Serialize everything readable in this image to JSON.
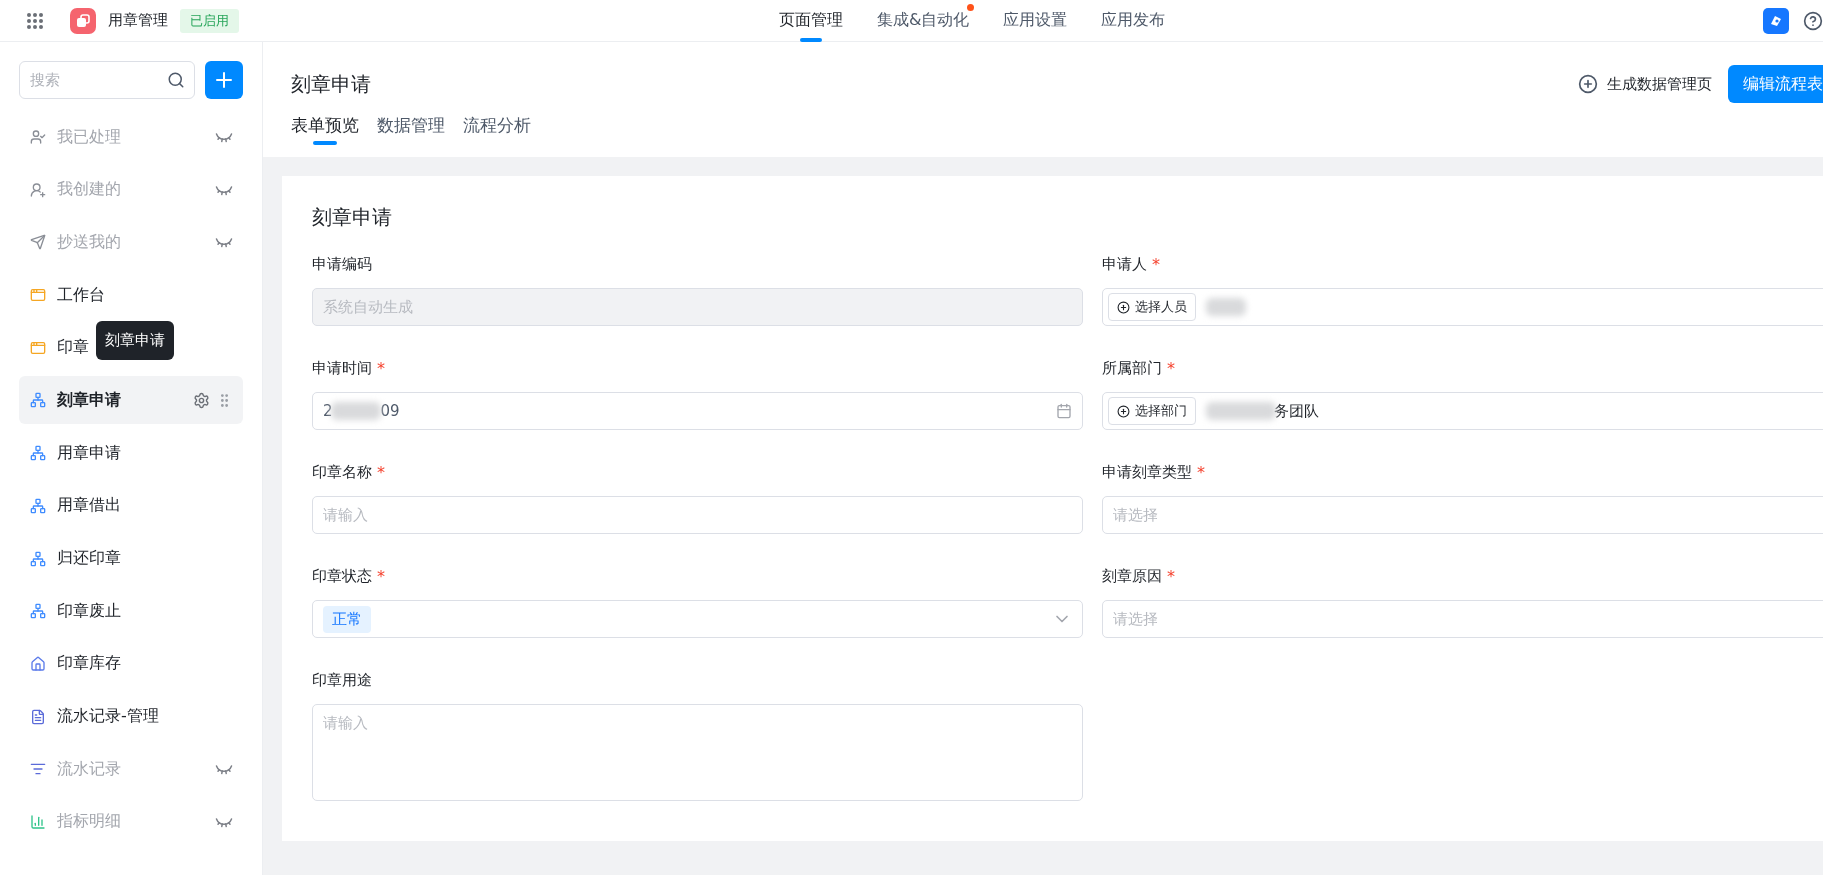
{
  "app_bar": {
    "app_name": "用章管理",
    "status_badge": "已启用",
    "nav": [
      {
        "label": "页面管理",
        "selected": true,
        "notice": false
      },
      {
        "label": "集成&自动化",
        "selected": false,
        "notice": true
      },
      {
        "label": "应用设置",
        "selected": false,
        "notice": false
      },
      {
        "label": "应用发布",
        "selected": false,
        "notice": false
      }
    ]
  },
  "sidebar": {
    "search": {
      "placeholder": "搜索"
    },
    "items": [
      {
        "label": "我已处理",
        "kind": "handled",
        "hidden": true,
        "selected": false
      },
      {
        "label": "我创建的",
        "kind": "created",
        "hidden": true,
        "selected": false
      },
      {
        "label": "抄送我的",
        "kind": "cc",
        "hidden": true,
        "selected": false
      },
      {
        "label": "工作台",
        "kind": "page",
        "hidden": false,
        "selected": false
      },
      {
        "label": "印章",
        "kind": "page",
        "hidden": false,
        "selected": false
      },
      {
        "label": "刻章申请",
        "kind": "process",
        "hidden": false,
        "selected": true
      },
      {
        "label": "用章申请",
        "kind": "process",
        "hidden": false,
        "selected": false
      },
      {
        "label": "用章借出",
        "kind": "process",
        "hidden": false,
        "selected": false
      },
      {
        "label": "归还印章",
        "kind": "process",
        "hidden": false,
        "selected": false
      },
      {
        "label": "印章废止",
        "kind": "process",
        "hidden": false,
        "selected": false
      },
      {
        "label": "印章库存",
        "kind": "home",
        "hidden": false,
        "selected": false
      },
      {
        "label": "流水记录-管理",
        "kind": "report",
        "hidden": false,
        "selected": false
      },
      {
        "label": "流水记录",
        "kind": "list",
        "hidden": true,
        "selected": false
      },
      {
        "label": "指标明细",
        "kind": "chart",
        "hidden": true,
        "selected": false
      }
    ],
    "tooltip": "刻章申请"
  },
  "page": {
    "title": "刻章申请",
    "tabs": [
      {
        "label": "表单预览",
        "selected": true
      },
      {
        "label": "数据管理",
        "selected": false
      },
      {
        "label": "流程分析",
        "selected": false
      }
    ],
    "generate_link": "生成数据管理页",
    "edit_button": "编辑流程表"
  },
  "form": {
    "title": "刻章申请",
    "fields": [
      {
        "label": "申请编码",
        "kind": "text",
        "disabled": true,
        "placeholder": "系统自动生成"
      },
      {
        "label": "申请人",
        "required_mark": "*",
        "kind": "member",
        "button": "选择人员",
        "blurred": true
      },
      {
        "label": "申请时间",
        "required_mark": "*",
        "kind": "date",
        "blurred": true,
        "value_start": "2",
        "value_end": "09"
      },
      {
        "label": "所属部门",
        "required_mark": "*",
        "kind": "member",
        "button": "选择部门",
        "blurred": true,
        "value_end": "务团队"
      },
      {
        "label": "印章名称",
        "required_mark": "*",
        "kind": "text",
        "disabled": false,
        "placeholder": "请输入"
      },
      {
        "label": "申请刻章类型",
        "required_mark": "*",
        "kind": "select",
        "placeholder": "请选择"
      },
      {
        "label": "印章状态",
        "required_mark": "*",
        "kind": "tag-select",
        "tag": "正常"
      },
      {
        "label": "刻章原因",
        "required_mark": "*",
        "kind": "select",
        "placeholder": "请选择"
      },
      {
        "label": "印章用途",
        "kind": "textarea",
        "placeholder": "请输入"
      }
    ]
  }
}
